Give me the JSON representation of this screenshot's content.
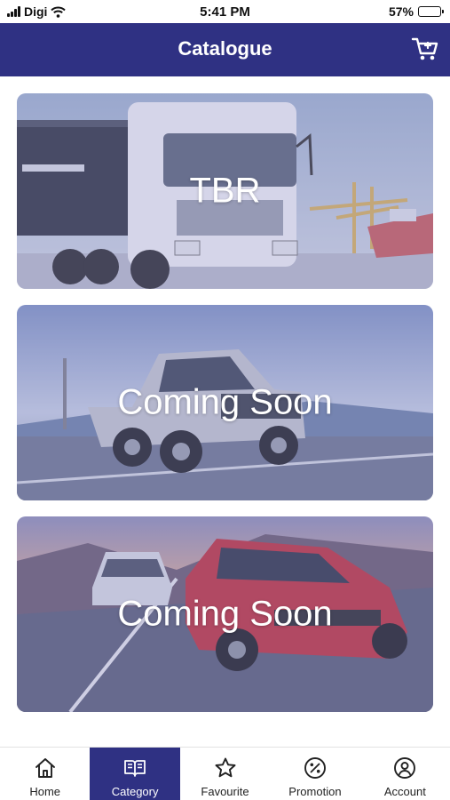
{
  "status_bar": {
    "carrier": "Digi",
    "time": "5:41 PM",
    "battery_percent": "57%",
    "battery_level": 0.57
  },
  "header": {
    "title": "Catalogue",
    "cart_icon": "cart-icon"
  },
  "catalogue": {
    "items": [
      {
        "label": "TBR",
        "image": "isuzu-truck-photo"
      },
      {
        "label": "Coming Soon",
        "image": "pickup-truck-photo"
      },
      {
        "label": "Coming Soon",
        "image": "sedan-cars-photo"
      }
    ]
  },
  "tabs": [
    {
      "label": "Home",
      "icon": "home-icon",
      "active": false
    },
    {
      "label": "Category",
      "icon": "book-icon",
      "active": true
    },
    {
      "label": "Favourite",
      "icon": "star-icon",
      "active": false
    },
    {
      "label": "Promotion",
      "icon": "percent-icon",
      "active": false
    },
    {
      "label": "Account",
      "icon": "user-icon",
      "active": false
    }
  ],
  "colors": {
    "brand": "#2f3183",
    "overlay": "#8c8cc8",
    "tab_active_text": "#ffffff"
  }
}
